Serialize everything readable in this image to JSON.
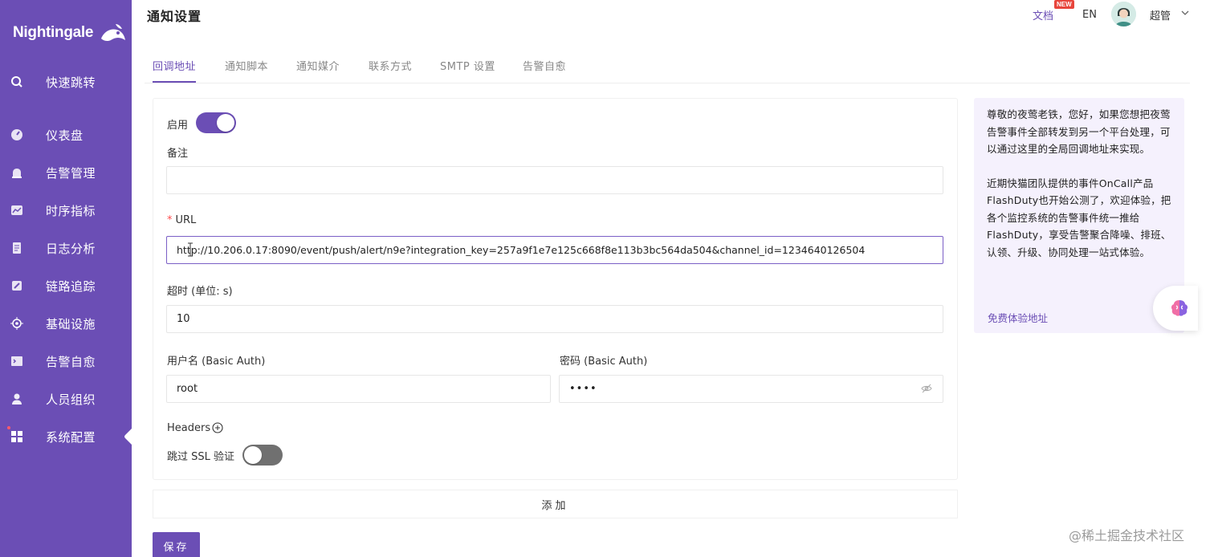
{
  "app": {
    "logo_text": "Nightingale"
  },
  "sidebar": {
    "items": [
      {
        "label": "快速跳转",
        "icon": "search-icon"
      },
      {
        "label": "仪表盘",
        "icon": "dashboard-icon"
      },
      {
        "label": "告警管理",
        "icon": "alarm-icon"
      },
      {
        "label": "时序指标",
        "icon": "chart-icon"
      },
      {
        "label": "日志分析",
        "icon": "log-icon"
      },
      {
        "label": "链路追踪",
        "icon": "trace-icon"
      },
      {
        "label": "基础设施",
        "icon": "target-icon"
      },
      {
        "label": "告警自愈",
        "icon": "terminal-icon"
      },
      {
        "label": "人员组织",
        "icon": "user-icon"
      },
      {
        "label": "系统配置",
        "icon": "grid-icon",
        "active": true
      }
    ]
  },
  "header": {
    "title": "通知设置",
    "docs": "文档",
    "docs_badge": "NEW",
    "lang": "EN",
    "user": "超管"
  },
  "tabs": [
    {
      "label": "回调地址",
      "active": true
    },
    {
      "label": "通知脚本"
    },
    {
      "label": "通知媒介"
    },
    {
      "label": "联系方式"
    },
    {
      "label": "SMTP 设置"
    },
    {
      "label": "告警自愈"
    }
  ],
  "form": {
    "enable_label": "启用",
    "enable_on": true,
    "note_label": "备注",
    "note_value": "",
    "url_label": "URL",
    "url_value": "http://10.206.0.17:8090/event/push/alert/n9e?integration_key=257a9f1e7e125c668f8e113b3bc564da504&channel_id=1234640126504",
    "timeout_label": "超时 (单位: s)",
    "timeout_value": "10",
    "username_label": "用户名 (Basic Auth)",
    "username_value": "root",
    "password_label": "密码 (Basic Auth)",
    "password_value": "••••",
    "headers_label": "Headers",
    "skip_ssl_label": "跳过 SSL 验证",
    "skip_ssl_on": false,
    "add_label": "添加",
    "save_label": "保存"
  },
  "info": {
    "para1": "尊敬的夜莺老铁，您好，如果您想把夜莺告警事件全部转发到另一个平台处理，可以通过这里的全局回调地址来实现。",
    "para2": "近期快猫团队提供的事件OnCall产品FlashDuty也开始公测了，欢迎体验，把各个监控系统的告警事件统一推给FlashDuty，享受告警聚合降噪、排班、认领、升级、协同处理一站式体验。",
    "link": "免费体验地址"
  },
  "watermark": "@稀土掘金技术社区",
  "colors": {
    "brand": "#6b4eb5",
    "sidebar": "#6b4eb5",
    "info_bg": "#f5f1fd"
  }
}
